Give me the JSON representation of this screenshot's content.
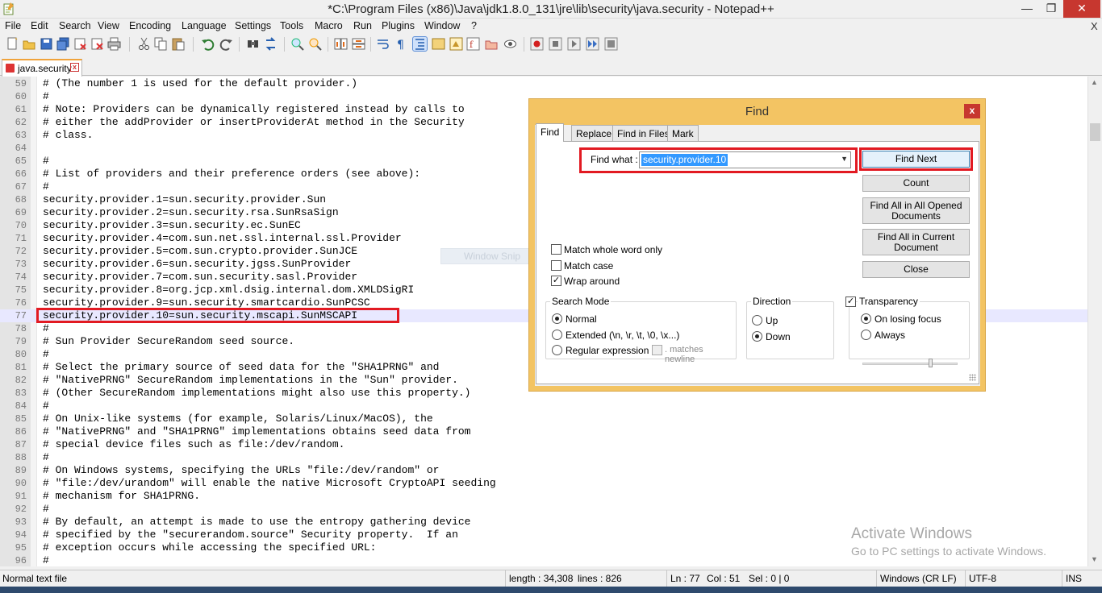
{
  "window": {
    "title": "*C:\\Program Files (x86)\\Java\\jdk1.8.0_131\\jre\\lib\\security\\java.security - Notepad++",
    "min_glyph": "—",
    "max_glyph": "❐",
    "close_glyph": "✕"
  },
  "menu": [
    "File",
    "Edit",
    "Search",
    "View",
    "Encoding",
    "Language",
    "Settings",
    "Tools",
    "Macro",
    "Run",
    "Plugins",
    "Window",
    "?"
  ],
  "menu_close": "X",
  "tab": {
    "label": "java.security",
    "close_glyph": "x"
  },
  "editor": {
    "lines": [
      {
        "num": "59",
        "text": "# (The number 1 is used for the default provider.)"
      },
      {
        "num": "60",
        "text": "#"
      },
      {
        "num": "61",
        "text": "# Note: Providers can be dynamically registered instead by calls to"
      },
      {
        "num": "62",
        "text": "# either the addProvider or insertProviderAt method in the Security"
      },
      {
        "num": "63",
        "text": "# class."
      },
      {
        "num": "64",
        "text": ""
      },
      {
        "num": "65",
        "text": "#"
      },
      {
        "num": "66",
        "text": "# List of providers and their preference orders (see above):"
      },
      {
        "num": "67",
        "text": "#"
      },
      {
        "num": "68",
        "text": "security.provider.1=sun.security.provider.Sun"
      },
      {
        "num": "69",
        "text": "security.provider.2=sun.security.rsa.SunRsaSign"
      },
      {
        "num": "70",
        "text": "security.provider.3=sun.security.ec.SunEC"
      },
      {
        "num": "71",
        "text": "security.provider.4=com.sun.net.ssl.internal.ssl.Provider"
      },
      {
        "num": "72",
        "text": "security.provider.5=com.sun.crypto.provider.SunJCE"
      },
      {
        "num": "73",
        "text": "security.provider.6=sun.security.jgss.SunProvider"
      },
      {
        "num": "74",
        "text": "security.provider.7=com.sun.security.sasl.Provider"
      },
      {
        "num": "75",
        "text": "security.provider.8=org.jcp.xml.dsig.internal.dom.XMLDSigRI"
      },
      {
        "num": "76",
        "text": "security.provider.9=sun.security.smartcardio.SunPCSC"
      },
      {
        "num": "77",
        "text": "security.provider.10=sun.security.mscapi.SunMSCAPI"
      },
      {
        "num": "78",
        "text": "#"
      },
      {
        "num": "79",
        "text": "# Sun Provider SecureRandom seed source."
      },
      {
        "num": "80",
        "text": "#"
      },
      {
        "num": "81",
        "text": "# Select the primary source of seed data for the \"SHA1PRNG\" and"
      },
      {
        "num": "82",
        "text": "# \"NativePRNG\" SecureRandom implementations in the \"Sun\" provider."
      },
      {
        "num": "83",
        "text": "# (Other SecureRandom implementations might also use this property.)"
      },
      {
        "num": "84",
        "text": "#"
      },
      {
        "num": "85",
        "text": "# On Unix-like systems (for example, Solaris/Linux/MacOS), the"
      },
      {
        "num": "86",
        "text": "# \"NativePRNG\" and \"SHA1PRNG\" implementations obtains seed data from"
      },
      {
        "num": "87",
        "text": "# special device files such as file:/dev/random."
      },
      {
        "num": "88",
        "text": "#"
      },
      {
        "num": "89",
        "text": "# On Windows systems, specifying the URLs \"file:/dev/random\" or"
      },
      {
        "num": "90",
        "text": "# \"file:/dev/urandom\" will enable the native Microsoft CryptoAPI seeding"
      },
      {
        "num": "91",
        "text": "# mechanism for SHA1PRNG."
      },
      {
        "num": "92",
        "text": "#"
      },
      {
        "num": "93",
        "text": "# By default, an attempt is made to use the entropy gathering device"
      },
      {
        "num": "94",
        "text": "# specified by the \"securerandom.source\" Security property.  If an"
      },
      {
        "num": "95",
        "text": "# exception occurs while accessing the specified URL:"
      },
      {
        "num": "96",
        "text": "#"
      }
    ],
    "current_line": "77"
  },
  "watermark": {
    "line1": "Activate Windows",
    "line2": "Go to PC settings to activate Windows."
  },
  "snip_ghost": "Window Snip",
  "status": {
    "file_type": "Normal text file",
    "length": "length : 34,308",
    "lines": "lines : 826",
    "ln": "Ln : 77",
    "col": "Col : 51",
    "sel": "Sel : 0 | 0",
    "eol": "Windows (CR LF)",
    "encoding": "UTF-8",
    "mode": "INS"
  },
  "find": {
    "title": "Find",
    "close_glyph": "x",
    "tabs": [
      "Find",
      "Replace",
      "Find in Files",
      "Mark"
    ],
    "find_what_label": "Find what :",
    "find_what_value": "security.provider.10",
    "buttons": {
      "find_next": "Find Next",
      "count": "Count",
      "find_all_opened_1": "Find All in All Opened",
      "find_all_opened_2": "Documents",
      "find_all_current_1": "Find All in Current",
      "find_all_current_2": "Document",
      "close": "Close"
    },
    "options": {
      "whole_word": "Match whole word only",
      "match_case": "Match case",
      "wrap_around": "Wrap around",
      "whole_word_checked": false,
      "match_case_checked": false,
      "wrap_around_checked": true
    },
    "search_mode": {
      "label": "Search Mode",
      "normal": "Normal",
      "extended": "Extended (\\n, \\r, \\t, \\0, \\x...)",
      "regex": "Regular expression",
      "matches_newline": ". matches newline",
      "selected": "Normal"
    },
    "direction": {
      "label": "Direction",
      "up": "Up",
      "down": "Down",
      "selected": "Down"
    },
    "transparency": {
      "label": "Transparency",
      "checked": true,
      "on_losing_focus": "On losing focus",
      "always": "Always",
      "selected": "On losing focus",
      "level": 0.7
    }
  },
  "colors": {
    "dialog_frame": "#f3c463",
    "highlight_red": "#e21a22",
    "current_line": "#e8e8ff",
    "selection": "#3399ff"
  }
}
